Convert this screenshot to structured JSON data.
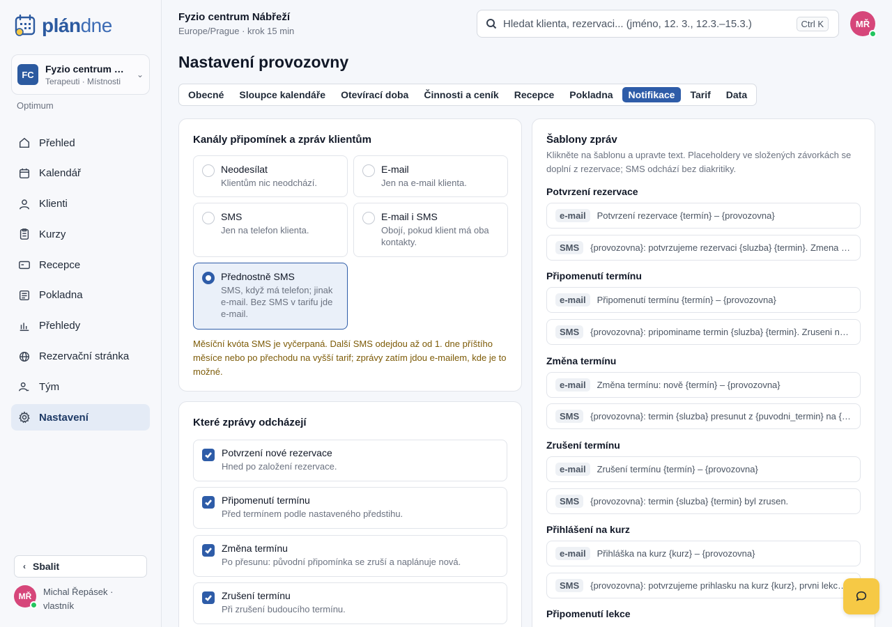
{
  "brand": {
    "name_bold": "plán",
    "name_light": "dne"
  },
  "workspace": {
    "badge": "FC",
    "name": "Fyzio centrum Nábřeží",
    "sub": "Terapeuti · Místnosti"
  },
  "plan": "Optimum",
  "nav": [
    {
      "label": "Přehled",
      "icon": "home-icon"
    },
    {
      "label": "Kalendář",
      "icon": "calendar-icon"
    },
    {
      "label": "Klienti",
      "icon": "user-icon"
    },
    {
      "label": "Kurzy",
      "icon": "clipboard-icon"
    },
    {
      "label": "Recepce",
      "icon": "card-icon"
    },
    {
      "label": "Pokladna",
      "icon": "register-icon"
    },
    {
      "label": "Přehledy",
      "icon": "bar-chart-icon"
    },
    {
      "label": "Rezervační stránka",
      "icon": "globe-icon"
    },
    {
      "label": "Tým",
      "icon": "team-icon"
    },
    {
      "label": "Nastavení",
      "icon": "gear-icon"
    }
  ],
  "collapse_label": "Sbalit",
  "user": {
    "initials": "MŘ",
    "name": "Michal Řepásek ·",
    "role": "vlastník"
  },
  "header": {
    "title": "Fyzio centrum Nábřeží",
    "sub": "Europe/Prague · krok 15 min"
  },
  "search": {
    "placeholder": "Hledat klienta, rezervaci... (jméno, 12. 3., 12.3.–15.3.)",
    "shortcut": "Ctrl K"
  },
  "page_title": "Nastavení provozovny",
  "tabs": [
    "Obecné",
    "Sloupce kalendáře",
    "Otevírací doba",
    "Činnosti a ceník",
    "Recepce",
    "Pokladna",
    "Notifikace",
    "Tarif",
    "Data"
  ],
  "active_tab": "Notifikace",
  "channels": {
    "title": "Kanály připomínek a zpráv klientům",
    "options": [
      {
        "title": "Neodesílat",
        "desc": "Klientům nic neodchází."
      },
      {
        "title": "E-mail",
        "desc": "Jen na e-mail klienta."
      },
      {
        "title": "SMS",
        "desc": "Jen na telefon klienta."
      },
      {
        "title": "E-mail i SMS",
        "desc": "Obojí, pokud klient má oba kontakty."
      },
      {
        "title": "Přednostně SMS",
        "desc": "SMS, když má telefon; jinak e-mail. Bez SMS v tarifu jde e-mail."
      }
    ],
    "selected": "Přednostně SMS",
    "warning": "Měsíční kvóta SMS je vyčerpaná. Další SMS odejdou až od 1. dne příštího měsíce nebo po přechodu na vyšší tarif; zprávy zatím jdou e-mailem, kde je to možné."
  },
  "messages": {
    "title": "Které zprávy odcházejí",
    "items": [
      {
        "title": "Potvrzení nové rezervace",
        "desc": "Hned po založení rezervace.",
        "checked": true
      },
      {
        "title": "Připomenutí termínu",
        "desc": "Před termínem podle nastaveného předstihu.",
        "checked": true
      },
      {
        "title": "Změna termínu",
        "desc": "Po přesunu: původní připomínka se zruší a naplánuje nová.",
        "checked": true
      },
      {
        "title": "Zrušení termínu",
        "desc": "Při zrušení budoucího termínu.",
        "checked": true
      }
    ]
  },
  "templates": {
    "title": "Šablony zpráv",
    "desc": "Klikněte na šablonu a upravte text. Placeholdery ve složených závorkách se doplní z rezervace; SMS odchází bez diakritiky.",
    "groups": [
      {
        "name": "Potvrzení rezervace",
        "email": "Potvrzení rezervace {termín} – {provozovna}",
        "sms": "{provozovna}: potvrzujeme rezervaci {sluzba} {termin}. Zmena nebo zruseni na odkazu."
      },
      {
        "name": "Připomenutí termínu",
        "email": "Připomenutí termínu {termín} – {provozovna}",
        "sms": "{provozovna}: pripominame termin {sluzba} {termin}. Zruseni na odkazu."
      },
      {
        "name": "Změna termínu",
        "email": "Změna termínu: nově {termín} – {provozovna}",
        "sms": "{provozovna}: termin {sluzba} presunut z {puvodni_termin} na {termin}."
      },
      {
        "name": "Zrušení termínu",
        "email": "Zrušení termínu {termín} – {provozovna}",
        "sms": "{provozovna}: termin {sluzba} {termin} byl zrusen."
      },
      {
        "name": "Přihlášení na kurz",
        "email": "Přihláška na kurz {kurz} – {provozovna}",
        "sms": "{provozovna}: potvrzujeme prihlasku na kurz {kurz}, prvni lekce {termin}."
      },
      {
        "name": "Připomenutí lekce"
      }
    ],
    "tag_email": "e-mail",
    "tag_sms": "SMS"
  },
  "colors": {
    "accent": "#2e5ca8",
    "warning_text": "#7c5a06",
    "fab": "#f6c945",
    "avatar": "#d6467a",
    "online": "#22c55e"
  }
}
